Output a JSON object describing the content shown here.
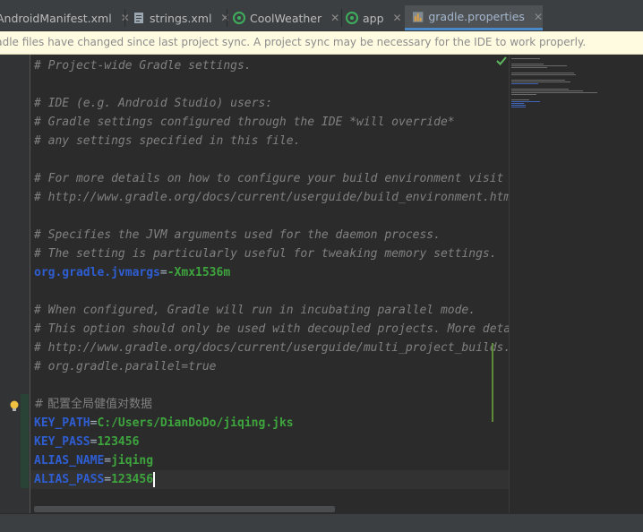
{
  "tabs": [
    {
      "label": "AndroidManifest.xml",
      "icon": "xml-file-icon",
      "active": false
    },
    {
      "label": "strings.xml",
      "icon": "xml-file-icon",
      "active": false
    },
    {
      "label": "CoolWeather",
      "icon": "gradle-module-icon",
      "active": false
    },
    {
      "label": "app",
      "icon": "gradle-module-icon",
      "active": false
    },
    {
      "label": "gradle.properties",
      "icon": "properties-file-icon",
      "active": true
    }
  ],
  "close_glyph": "✕",
  "notification": {
    "text": "Gradle files have changed since last project sync. A project sync may be necessary for the IDE to work properly."
  },
  "code": {
    "lines": {
      "l1": "# Project-wide Gradle settings.",
      "l3": "# IDE (e.g. Android Studio) users:",
      "l4": "# Gradle settings configured through the IDE *will override*",
      "l5": "# any settings specified in this file.",
      "l7": "# For more details on how to configure your build environment visit",
      "l8": "# http://www.gradle.org/docs/current/userguide/build_environment.html",
      "l10": "# Specifies the JVM arguments used for the daemon process.",
      "l11": "# The setting is particularly useful for tweaking memory settings.",
      "l14": "# When configured, Gradle will run in incubating parallel mode.",
      "l15": "# This option should only be used with decoupled projects. More details, visit",
      "l16": "# http://www.gradle.org/docs/current/userguide/multi_project_builds.html#sec:decoupled_projects",
      "l17": "# org.gradle.parallel=true",
      "l19": "# 配置全局健值对数据"
    },
    "props": {
      "jvmargs": {
        "key": "org.gradle.jvmargs",
        "value": "-Xmx1536m"
      },
      "key_path": {
        "key": "KEY_PATH",
        "value": "C:/Users/DianDoDo/jiqing.jks"
      },
      "key_pass": {
        "key": "KEY_PASS",
        "value": "123456"
      },
      "alias_name": {
        "key": "ALIAS_NAME",
        "value": "jiqing"
      },
      "alias_pass": {
        "key": "ALIAS_PASS",
        "value": "123456"
      }
    },
    "equals": "="
  },
  "colors": {
    "comment": "#808080",
    "key": "#2f5ed3",
    "value": "#3ea53e",
    "active_tab_underline": "#4a88c7",
    "notification_bg": "#fffbe1"
  }
}
